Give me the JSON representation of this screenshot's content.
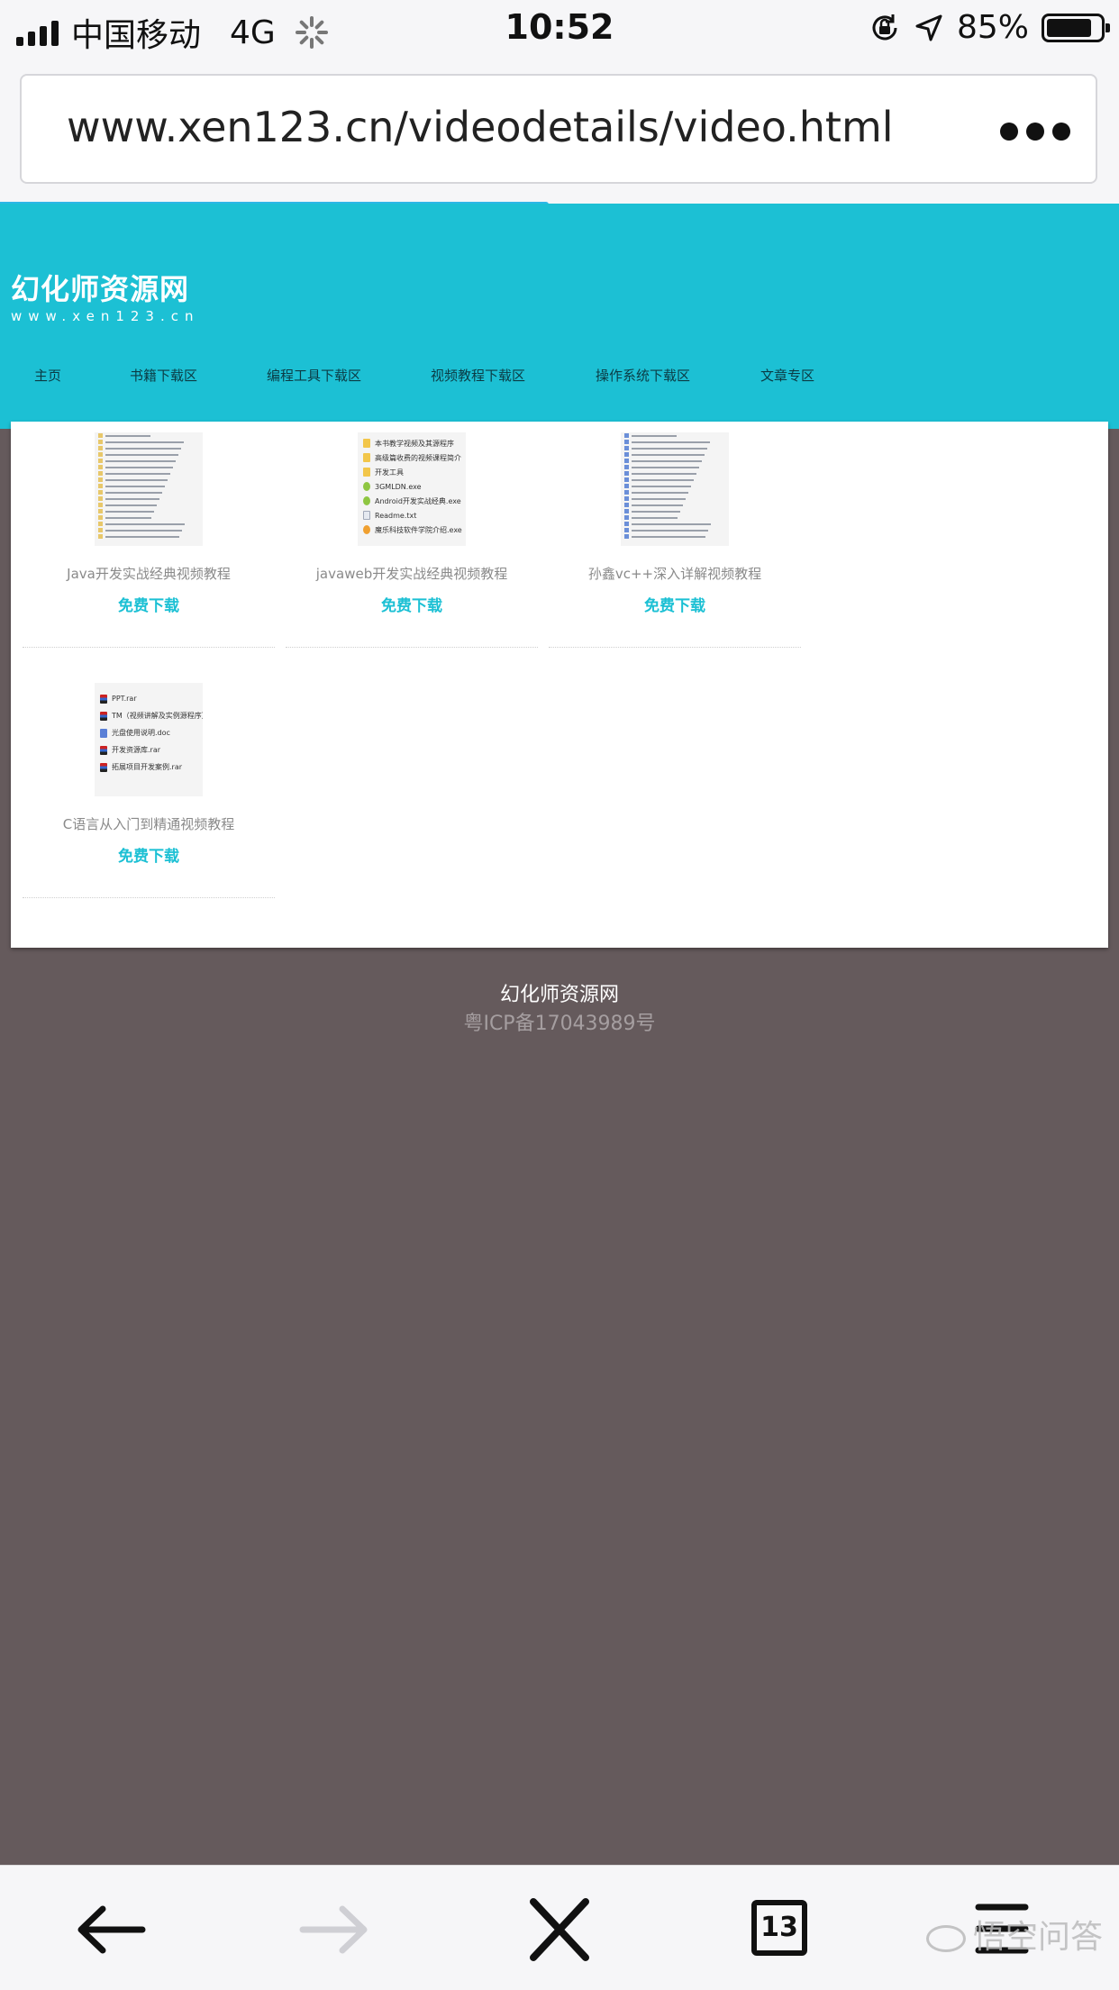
{
  "status_bar": {
    "carrier": "中国移动",
    "network": "4G",
    "time": "10:52",
    "battery_percent": "85%",
    "battery_level": 0.85
  },
  "browser": {
    "url": "www.xen123.cn/videodetails/video.html",
    "tabs_count": "13",
    "load_progress": 0.49
  },
  "site": {
    "logo_title": "幻化师资源网",
    "logo_subtitle": "www.xen123.cn",
    "nav": [
      "主页",
      "书籍下载区",
      "编程工具下载区",
      "视频教程下载区",
      "操作系统下载区",
      "文章专区"
    ]
  },
  "items": [
    {
      "title": "Java开发实战经典视频教程",
      "download_label": "免费下载"
    },
    {
      "title": "javaweb开发实战经典视频教程",
      "download_label": "免费下载",
      "files": [
        {
          "icon": "folder",
          "name": "本书教学视频及其源程序"
        },
        {
          "icon": "folder",
          "name": "高级篇收费的视频课程简介"
        },
        {
          "icon": "folder",
          "name": "开发工具"
        },
        {
          "icon": "android",
          "name": "3GMLDN.exe"
        },
        {
          "icon": "android",
          "name": "Android开发实战经典.exe"
        },
        {
          "icon": "txt",
          "name": "Readme.txt"
        },
        {
          "icon": "exe",
          "name": "魔乐科技软件学院介绍.exe"
        }
      ]
    },
    {
      "title": "孙鑫vc++深入详解视频教程",
      "download_label": "免费下载"
    },
    {
      "title": "C语言从入门到精通视频教程",
      "download_label": "免费下载",
      "files": [
        {
          "icon": "rar",
          "name": "PPT.rar"
        },
        {
          "icon": "rar",
          "name": "TM（视频讲解及实例源程序）.rar"
        },
        {
          "icon": "doc",
          "name": "光盘使用说明.doc"
        },
        {
          "icon": "rar",
          "name": "开发资源库.rar"
        },
        {
          "icon": "rar",
          "name": "拓展项目开发案例.rar"
        }
      ]
    }
  ],
  "footer": {
    "site_name": "幻化师资源网",
    "icp": "粤ICP备17043989号"
  },
  "toolbar": {
    "watermark": "悟空问答"
  }
}
